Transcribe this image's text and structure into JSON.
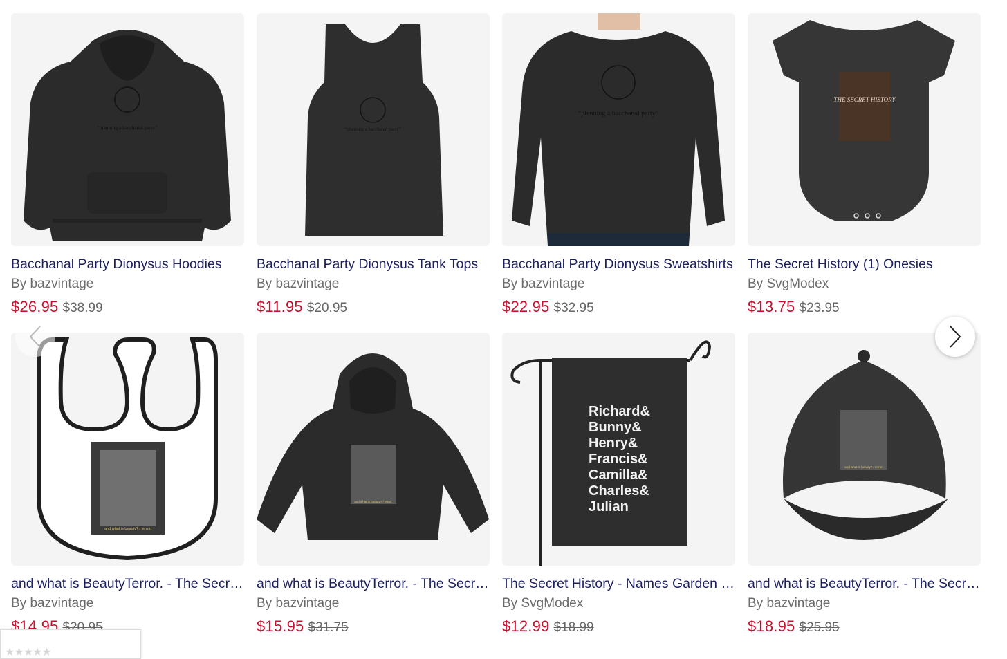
{
  "products": [
    {
      "title": "Bacchanal Party Dionysus Hoodies",
      "by": "By bazvintage",
      "price": "$26.95",
      "was": "$38.99",
      "print_text": "“planning a bacchanal party”"
    },
    {
      "title": "Bacchanal Party Dionysus Tank Tops",
      "by": "By bazvintage",
      "price": "$11.95",
      "was": "$20.95",
      "print_text": "“planning a bacchanal party”"
    },
    {
      "title": "Bacchanal Party Dionysus Sweatshirts",
      "by": "By bazvintage",
      "price": "$22.95",
      "was": "$32.95",
      "print_text": "“planning a bacchanal party”"
    },
    {
      "title": "The Secret History (1) Onesies",
      "by": "By SvgModex",
      "price": "$13.75",
      "was": "$23.95",
      "print_text": "THE SECRET HISTORY"
    },
    {
      "title": "and what is BeautyTerror. - The Secret History",
      "by": "By bazvintage",
      "price": "$14.95",
      "was": "$20.95",
      "print_text": "and what is beauty? / terror."
    },
    {
      "title": "and what is BeautyTerror. - The Secret History",
      "by": "By bazvintage",
      "price": "$15.95",
      "was": "$31.75",
      "print_text": "and what is beauty? / terror."
    },
    {
      "title": "The Secret History - Names Garden Flags",
      "by": "By SvgModex",
      "price": "$12.99",
      "was": "$18.99",
      "print_lines": [
        "Richard&",
        "Bunny&",
        "Henry&",
        "Francis&",
        "Camilla&",
        "Charles&",
        "Julian"
      ]
    },
    {
      "title": "and what is BeautyTerror. - The Secret History",
      "by": "By bazvintage",
      "price": "$18.95",
      "was": "$25.95",
      "print_text": "and what is beauty? / terror."
    }
  ],
  "carousel": {
    "prev_icon": "chevron-left-icon",
    "next_icon": "chevron-right-icon"
  },
  "rating_widget": {
    "icon": "star-rating-icon",
    "stars": "★★★★★"
  },
  "colors": {
    "title": "#1b1f5e",
    "price": "#c8102e",
    "muted": "#6b6b6b",
    "garment": "#2b2b2b"
  }
}
